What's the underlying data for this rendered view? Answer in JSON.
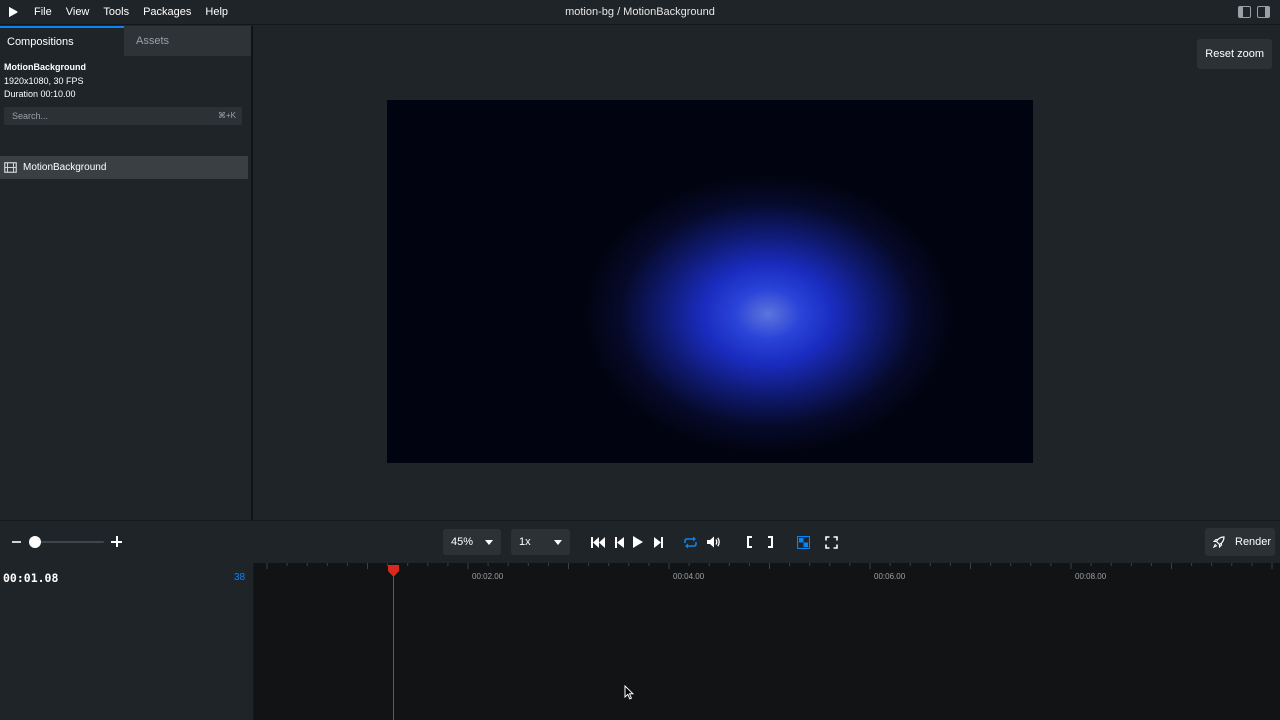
{
  "menubar": {
    "items": [
      "File",
      "View",
      "Tools",
      "Packages",
      "Help"
    ],
    "title": "motion-bg / MotionBackground"
  },
  "sidebar": {
    "tabs": [
      {
        "label": "Compositions",
        "active": true
      },
      {
        "label": "Assets",
        "active": false
      }
    ],
    "composition": {
      "name": "MotionBackground",
      "resolution": "1920x1080, 30 FPS",
      "duration": "Duration 00:10.00"
    },
    "search": {
      "placeholder": "Search...",
      "shortcut": "⌘+K"
    },
    "items": [
      {
        "label": "MotionBackground",
        "icon": "film-icon"
      }
    ]
  },
  "preview": {
    "reset_zoom": "Reset zoom",
    "gradient_colors": [
      "#5d75dc",
      "#2a43d8",
      "#1a2cc0",
      "#0f1a70",
      "#020310"
    ]
  },
  "controls": {
    "zoom_value": "45%",
    "speed_value": "1x",
    "render_label": "Render",
    "accent": "#0b84f3"
  },
  "timeline": {
    "timecode": "00:01.08",
    "frame": "38",
    "ticks": [
      "00:02.00",
      "00:04.00",
      "00:06.00",
      "00:08.00"
    ],
    "playhead_color": "#d9291f"
  }
}
